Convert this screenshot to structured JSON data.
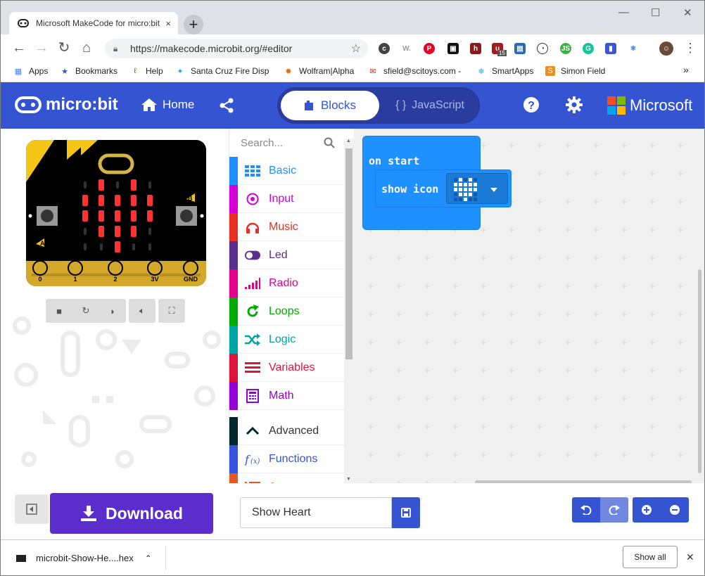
{
  "browser": {
    "tab_title": "Microsoft MakeCode for micro:bit",
    "tab_close": "×",
    "new_tab": "+",
    "url": "https://makecode.microbit.org/#editor",
    "window_controls": {
      "minimize": "—",
      "maximize": "☐",
      "close": "✕"
    },
    "extension_badge": "15"
  },
  "bookmarks": [
    {
      "label": "Apps",
      "icon": "apps-grid-icon"
    },
    {
      "label": "Bookmarks",
      "icon": "star-icon"
    },
    {
      "label": "Help",
      "icon": "help-icon"
    },
    {
      "label": "Santa Cruz Fire Disp",
      "icon": "twitter-icon"
    },
    {
      "label": "Wolfram|Alpha",
      "icon": "wolfram-icon"
    },
    {
      "label": "sfield@scitoys.com -",
      "icon": "gmail-icon"
    },
    {
      "label": "SmartApps",
      "icon": "smartapps-icon"
    },
    {
      "label": "Simon Field",
      "icon": "simon-icon"
    }
  ],
  "bookmarks_overflow": "»",
  "header": {
    "logo_text": "micro:bit",
    "home_label": "Home",
    "blocks_label": "Blocks",
    "javascript_label": "JavaScript",
    "brand": "Microsoft"
  },
  "simulator": {
    "pins": [
      "0",
      "1",
      "2",
      "3V",
      "GND"
    ],
    "button_a": "A",
    "button_b": "B"
  },
  "toolbox": {
    "search_placeholder": "Search...",
    "categories": [
      {
        "label": "Basic",
        "color": "#1e90ff",
        "icon": "basic-grid-icon"
      },
      {
        "label": "Input",
        "color": "#d400d4",
        "icon": "input-target-icon"
      },
      {
        "label": "Music",
        "color": "#e63022",
        "icon": "headphones-icon"
      },
      {
        "label": "Led",
        "color": "#5c2d91",
        "icon": "toggle-icon"
      },
      {
        "label": "Radio",
        "color": "#e3008c",
        "icon": "signal-bars-icon"
      },
      {
        "label": "Loops",
        "color": "#00aa00",
        "icon": "loop-arrow-icon"
      },
      {
        "label": "Logic",
        "color": "#00a4a6",
        "icon": "shuffle-icon"
      },
      {
        "label": "Variables",
        "color": "#dc143c",
        "icon": "lines-icon"
      },
      {
        "label": "Math",
        "color": "#9400d3",
        "icon": "calculator-icon"
      },
      {
        "label": "Advanced",
        "color": "#00272b",
        "icon": "chevron-up-icon"
      },
      {
        "label": "Functions",
        "color": "#3455db",
        "icon": "function-icon"
      },
      {
        "label": "Arrays",
        "color": "#e65722",
        "icon": "list-icon"
      }
    ]
  },
  "workspace": {
    "hat_label": "on start",
    "statement_label": "show icon",
    "icon_value": "heart"
  },
  "bottom": {
    "download_label": "Download",
    "project_name": "Show Heart"
  },
  "shelf": {
    "file_name": "microbit-Show-He....hex",
    "show_all": "Show all",
    "close": "✕"
  }
}
